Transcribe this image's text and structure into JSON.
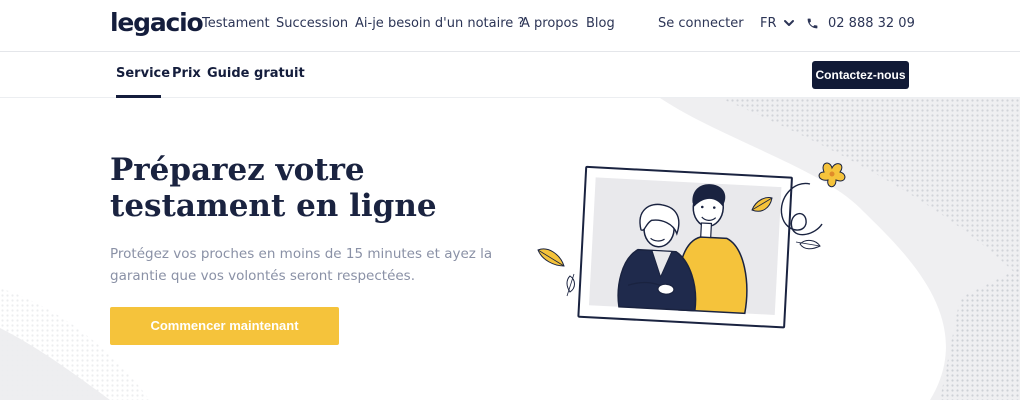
{
  "header": {
    "logo": "legacio",
    "nav": [
      "Testament",
      "Succession",
      "Ai-je besoin d'un notaire ?",
      "A propos",
      "Blog"
    ],
    "login": "Se connecter",
    "language": "FR",
    "phone": "02 888 32 09"
  },
  "subnav": {
    "tabs": [
      "Service",
      "Prix",
      "Guide gratuit"
    ],
    "active_tab": "Service",
    "contact_label": "Contactez-nous"
  },
  "hero": {
    "title_line1": "Préparez votre",
    "title_line2": "testament en ligne",
    "subtitle_line1": "Protégez vos proches en moins de 15 minutes et ayez la",
    "subtitle_line2": "garantie que vos volontés seront respectées.",
    "cta_label": "Commencer maintenant"
  },
  "icons": {
    "language_toggle": "chevron-down-icon",
    "phone": "phone-icon"
  },
  "colors": {
    "navy": "#141d3c",
    "accent_yellow": "#f5c33b",
    "muted_text": "#8a91a6"
  }
}
